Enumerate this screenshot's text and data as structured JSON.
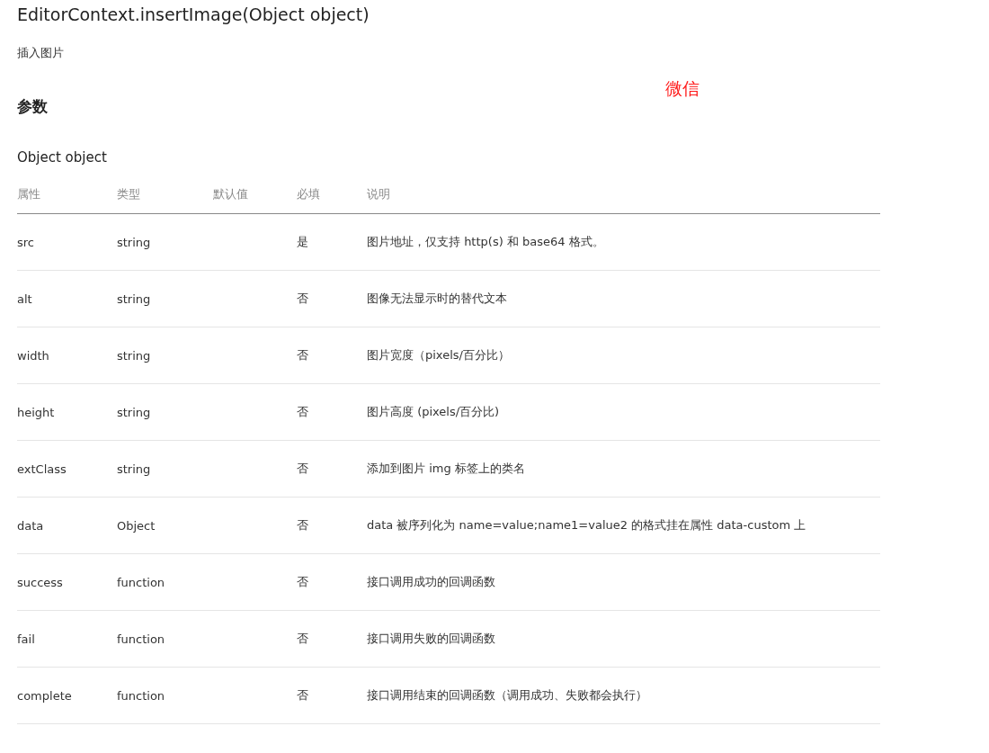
{
  "title": "EditorContext.insertImage(Object object)",
  "description": "插入图片",
  "annotation": "微信",
  "section_heading": "参数",
  "subheading": "Object object",
  "table": {
    "columns": [
      "属性",
      "类型",
      "默认值",
      "必填",
      "说明"
    ],
    "rows": [
      [
        "src",
        "string",
        "",
        "是",
        "图片地址，仅支持 http(s) 和 base64 格式。"
      ],
      [
        "alt",
        "string",
        "",
        "否",
        "图像无法显示时的替代文本"
      ],
      [
        "width",
        "string",
        "",
        "否",
        "图片宽度（pixels/百分比）"
      ],
      [
        "height",
        "string",
        "",
        "否",
        "图片高度 (pixels/百分比)"
      ],
      [
        "extClass",
        "string",
        "",
        "否",
        "添加到图片 img 标签上的类名"
      ],
      [
        "data",
        "Object",
        "",
        "否",
        "data 被序列化为 name=value;name1=value2 的格式挂在属性 data-custom 上"
      ],
      [
        "success",
        "function",
        "",
        "否",
        "接口调用成功的回调函数"
      ],
      [
        "fail",
        "function",
        "",
        "否",
        "接口调用失败的回调函数"
      ],
      [
        "complete",
        "function",
        "",
        "否",
        "接口调用结束的回调函数（调用成功、失败都会执行）"
      ]
    ]
  }
}
